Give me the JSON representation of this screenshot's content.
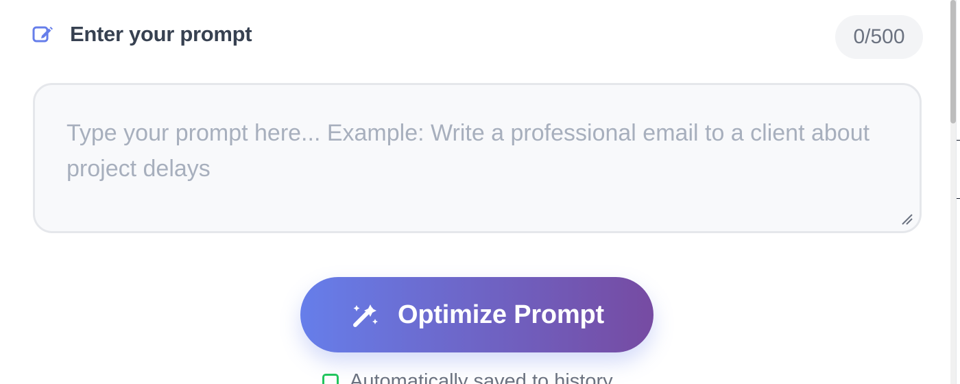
{
  "prompt_section": {
    "label": "Enter your prompt",
    "counter": "0/500",
    "input": {
      "value": "",
      "placeholder": "Type your prompt here... Example: Write a professional email to a client about project delays"
    }
  },
  "actions": {
    "optimize_label": "Optimize Prompt"
  },
  "footer": {
    "saved_note": "Automatically saved to history"
  },
  "icons": {
    "label_icon": "edit-icon",
    "button_icon": "magic-wand-icon",
    "footer_icon": "save-icon"
  },
  "colors": {
    "accent_start": "#667eea",
    "accent_end": "#764ba2",
    "label_text": "#374151",
    "muted_text": "#6b7280",
    "placeholder_text": "#a7afbd",
    "input_background": "#f8f9fb",
    "counter_background": "#f3f4f6",
    "success": "#22c55e"
  }
}
